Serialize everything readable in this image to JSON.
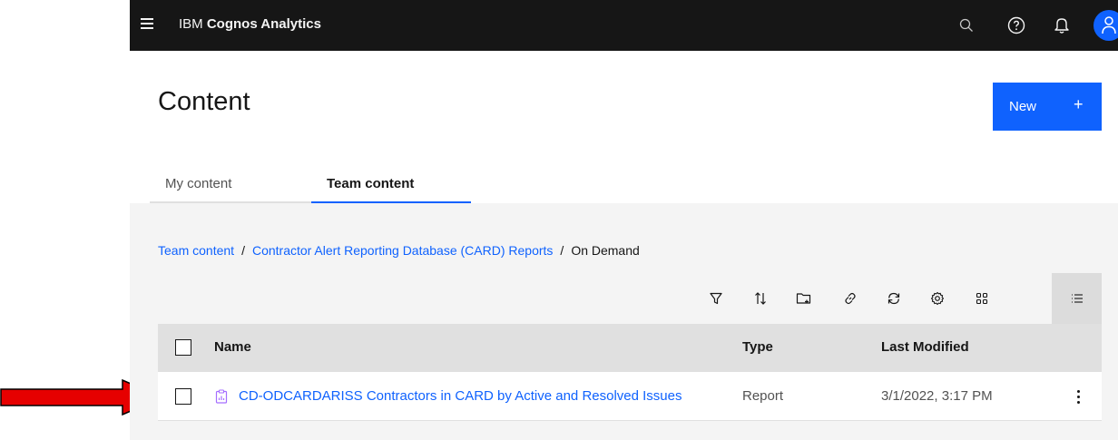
{
  "header": {
    "brand_prefix": "IBM",
    "brand_name": "Cognos Analytics",
    "icons": [
      "menu-icon",
      "search-icon",
      "help-icon",
      "notification-icon",
      "user-icon"
    ]
  },
  "page": {
    "title": "Content",
    "new_button_label": "New",
    "new_button_plus": "+"
  },
  "tabs": [
    {
      "label": "My content",
      "selected": false
    },
    {
      "label": "Team content",
      "selected": true
    }
  ],
  "breadcrumb": {
    "items": [
      "Team content",
      "Contractor Alert Reporting Database (CARD) Reports",
      "On Demand"
    ],
    "separator": "/"
  },
  "toolbar": {
    "icons": [
      "filter-icon",
      "sort-icon",
      "new-folder-icon",
      "link-icon",
      "refresh-icon",
      "settings-icon",
      "grid-view-icon",
      "list-view-icon"
    ],
    "active": "list-view-icon"
  },
  "table": {
    "columns": [
      "Name",
      "Type",
      "Last Modified"
    ],
    "rows": [
      {
        "name": "CD-ODCARDARISS Contractors in CARD by Active and Resolved Issues",
        "type": "Report",
        "modified": "3/1/2022, 3:17 PM",
        "icon": "report-icon"
      }
    ]
  },
  "colors": {
    "accent": "#0f62fe",
    "header_bg": "#161616",
    "panel_bg": "#f4f4f4",
    "annotation": "#e60000",
    "report_icon": "#a56eff"
  }
}
